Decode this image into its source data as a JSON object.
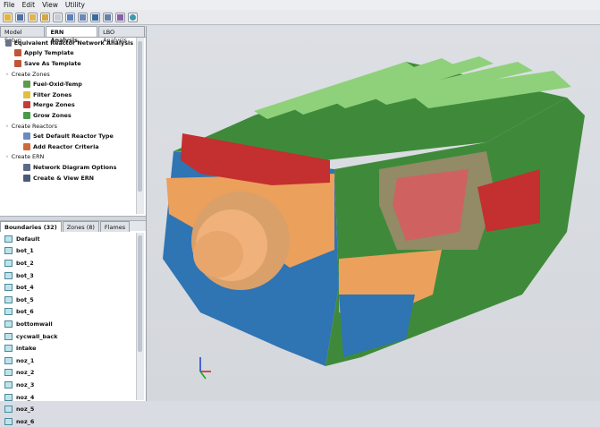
{
  "menu": [
    "File",
    "Edit",
    "View",
    "Utility"
  ],
  "toolbar_icons": [
    "open-folder-icon",
    "save-icon",
    "folder-icon",
    "folder-alt-icon",
    "blank-icon",
    "grid-icon",
    "mesh-icon",
    "image-icon",
    "chart-icon",
    "palette-icon",
    "globe-icon"
  ],
  "top_tabs": [
    "Model Setup",
    "ERN Analysis",
    "LBO Analysis"
  ],
  "tree": {
    "root": "Equivalent Reactor Network Analysis",
    "apply_template": "Apply Template",
    "save_template": "Save As Template",
    "create_zones": "Create Zones",
    "fuel_oxid_temp": "Fuel-Oxid-Temp",
    "filter_zones": "Filter Zones",
    "merge_zones": "Merge Zones",
    "grow_zones": "Grow Zones",
    "create_reactors": "Create Reactors",
    "set_default": "Set Default Reactor Type",
    "add_criteria": "Add Reactor Criteria",
    "create_ern": "Create ERN",
    "network_diagram": "Network Diagram Options",
    "create_view": "Create & View ERN"
  },
  "bottom_tabs": [
    "Boundaries (32)",
    "Zones (8)",
    "Flames"
  ],
  "boundaries": [
    "Default",
    "bot_1",
    "bot_2",
    "bot_3",
    "bot_4",
    "bot_5",
    "bot_6",
    "bottomwall",
    "cycwall_back",
    "intake",
    "noz_1",
    "noz_2",
    "noz_3",
    "noz_4",
    "noz_5",
    "noz_6"
  ],
  "colors": {
    "green": "#3f8a3a",
    "light_green": "#8fd17a",
    "red": "#c42f2f",
    "pink": "#d98a8a",
    "orange": "#eba05c",
    "blue": "#2f74b3"
  }
}
